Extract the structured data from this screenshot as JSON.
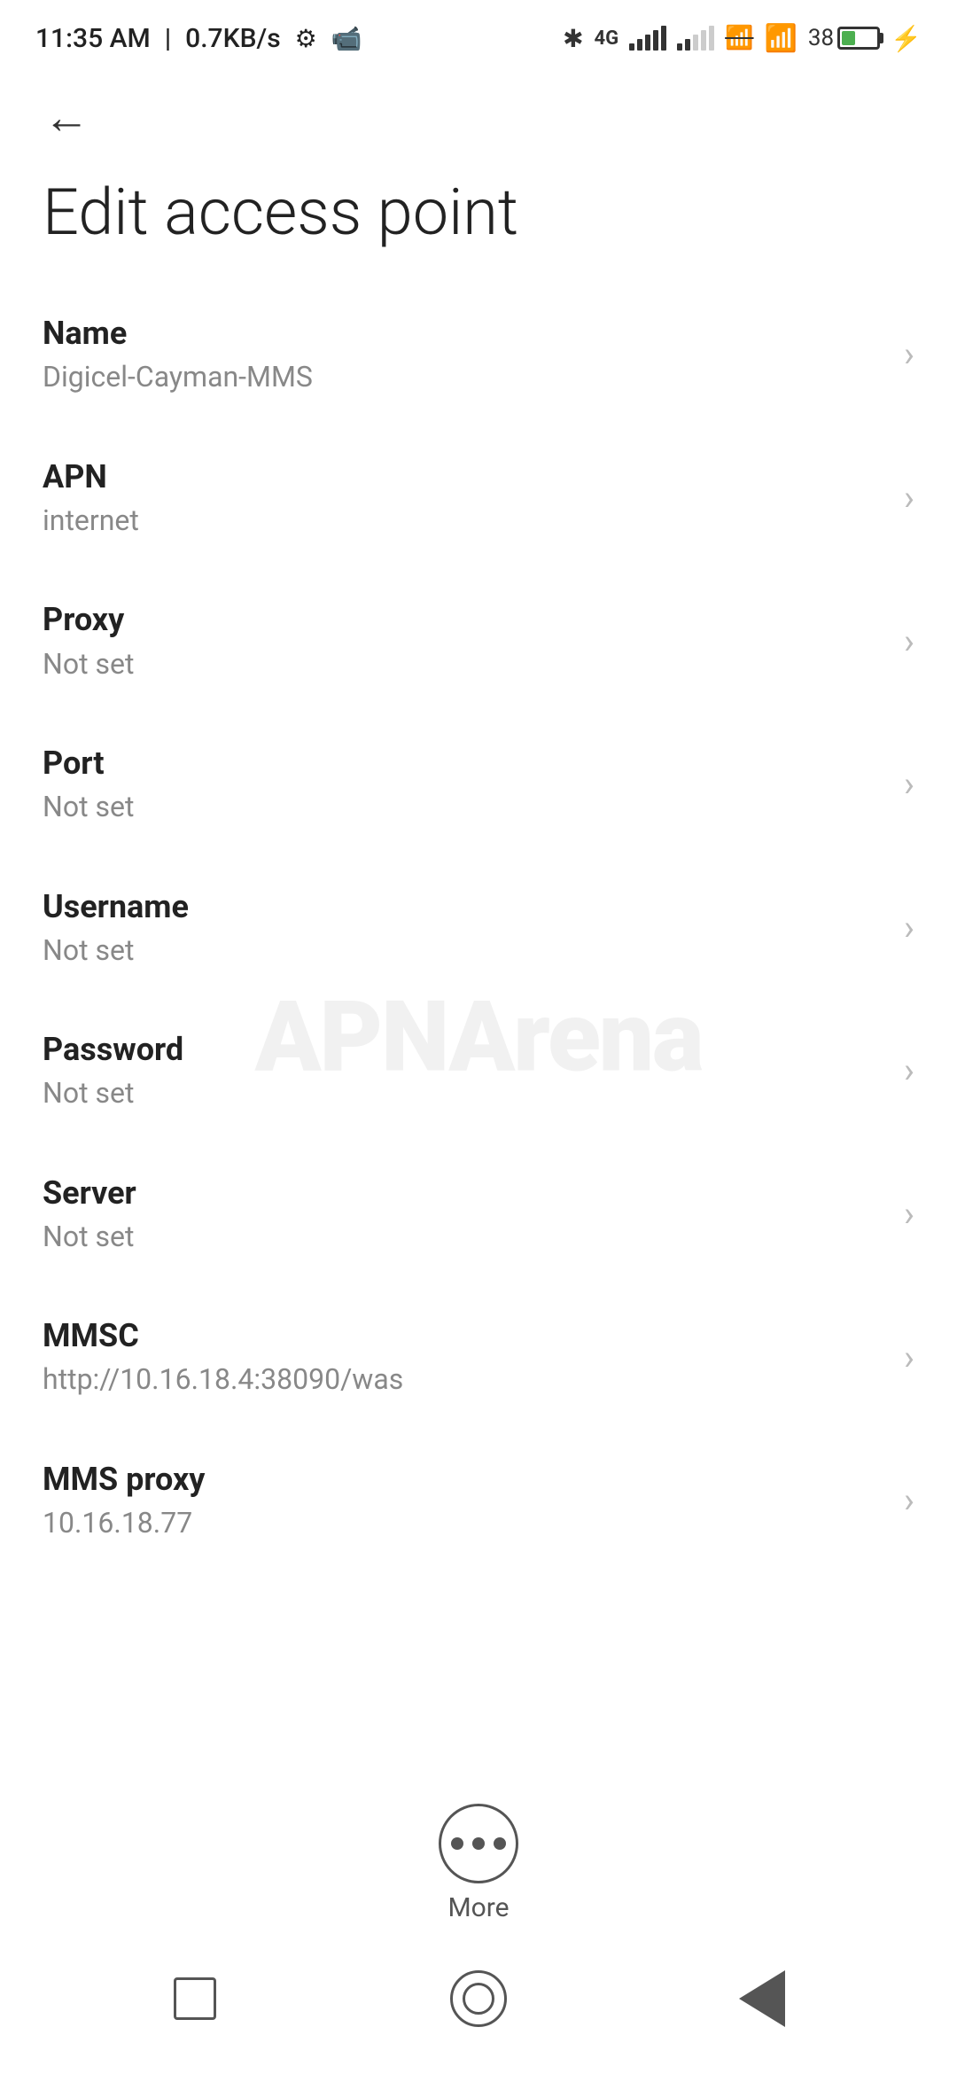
{
  "status_bar": {
    "time": "11:35 AM",
    "network_speed": "0.7KB/s"
  },
  "toolbar": {
    "back_label": "←"
  },
  "page": {
    "title": "Edit access point"
  },
  "settings_items": [
    {
      "label": "Name",
      "value": "Digicel-Cayman-MMS"
    },
    {
      "label": "APN",
      "value": "internet"
    },
    {
      "label": "Proxy",
      "value": "Not set"
    },
    {
      "label": "Port",
      "value": "Not set"
    },
    {
      "label": "Username",
      "value": "Not set"
    },
    {
      "label": "Password",
      "value": "Not set"
    },
    {
      "label": "Server",
      "value": "Not set"
    },
    {
      "label": "MMSC",
      "value": "http://10.16.18.4:38090/was"
    },
    {
      "label": "MMS proxy",
      "value": "10.16.18.77"
    }
  ],
  "more_button": {
    "label": "More"
  },
  "watermark": {
    "text": "APNArena"
  }
}
